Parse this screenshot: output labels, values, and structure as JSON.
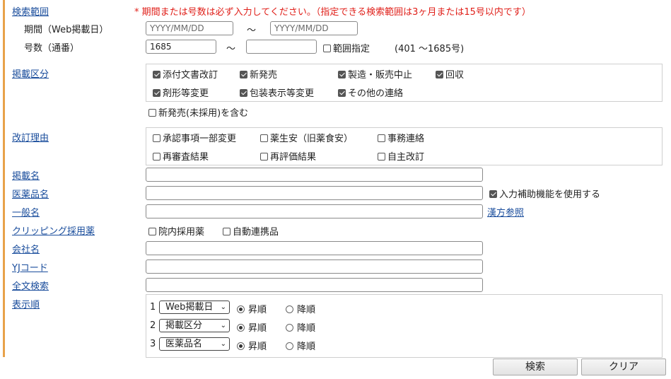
{
  "labels": {
    "search_range": "検索範囲",
    "period": "期間（Web掲載日）",
    "issue_number": "号数（通番）",
    "category": "掲載区分",
    "revision_reason": "改訂理由",
    "posting_name": "掲載名",
    "drug_name": "医薬品名",
    "generic_name": "一般名",
    "clipping": "クリッピング採用薬",
    "company_name": "会社名",
    "yj_code": "YJコード",
    "fulltext": "全文検索",
    "display_order": "表示順"
  },
  "notice": "*  期間または号数は必ず入力してください。（指定できる検索範囲は3ヶ月または15号以内です）",
  "period": {
    "from_placeholder": "YYYY/MM/DD",
    "to_placeholder": "YYYY/MM/DD",
    "tilde": "～"
  },
  "issue": {
    "from_value": "1685",
    "to_value": "",
    "tilde": "～",
    "range_label": "範囲指定",
    "range_checked": false,
    "range_info": "(401 ～1685号)"
  },
  "category_options": [
    {
      "label": "添付文書改訂",
      "checked": true
    },
    {
      "label": "新発売",
      "checked": true
    },
    {
      "label": "製造・販売中止",
      "checked": true
    },
    {
      "label": "回収",
      "checked": true
    },
    {
      "label": "剤形等変更",
      "checked": true
    },
    {
      "label": "包装表示等変更",
      "checked": true
    },
    {
      "label": "その他の連絡",
      "checked": true
    }
  ],
  "category_extra": {
    "label": "新発売(未採用)を含む",
    "checked": false
  },
  "revision_options": [
    {
      "label": "承認事項一部変更",
      "checked": false
    },
    {
      "label": "薬生安（旧薬食安）",
      "checked": false
    },
    {
      "label": "事務連絡",
      "checked": false
    },
    {
      "label": "再審査結果",
      "checked": false
    },
    {
      "label": "再評価結果",
      "checked": false
    },
    {
      "label": "自主改訂",
      "checked": false
    }
  ],
  "drug_assist": {
    "label": "入力補助機能を使用する",
    "checked": true
  },
  "kampo_link": "漢方参照",
  "clipping_options": [
    {
      "label": "院内採用薬",
      "checked": false
    },
    {
      "label": "自動連携品",
      "checked": false
    }
  ],
  "sort_rows": [
    {
      "num": "1",
      "field": "Web掲載日",
      "asc": "昇順",
      "desc": "降順",
      "asc_selected": true
    },
    {
      "num": "2",
      "field": "掲載区分",
      "asc": "昇順",
      "desc": "降順",
      "asc_selected": true
    },
    {
      "num": "3",
      "field": "医薬品名",
      "asc": "昇順",
      "desc": "降順",
      "asc_selected": true
    }
  ],
  "buttons": {
    "search": "検索",
    "clear": "クリア"
  },
  "colors": {
    "accent_bar": "#e8a24a",
    "link": "#1a4d9c",
    "notice": "#e0201a"
  },
  "icons": {
    "dropdown": "chevron-down-icon",
    "checkbox": "checkbox-icon",
    "radio": "radio-icon"
  }
}
